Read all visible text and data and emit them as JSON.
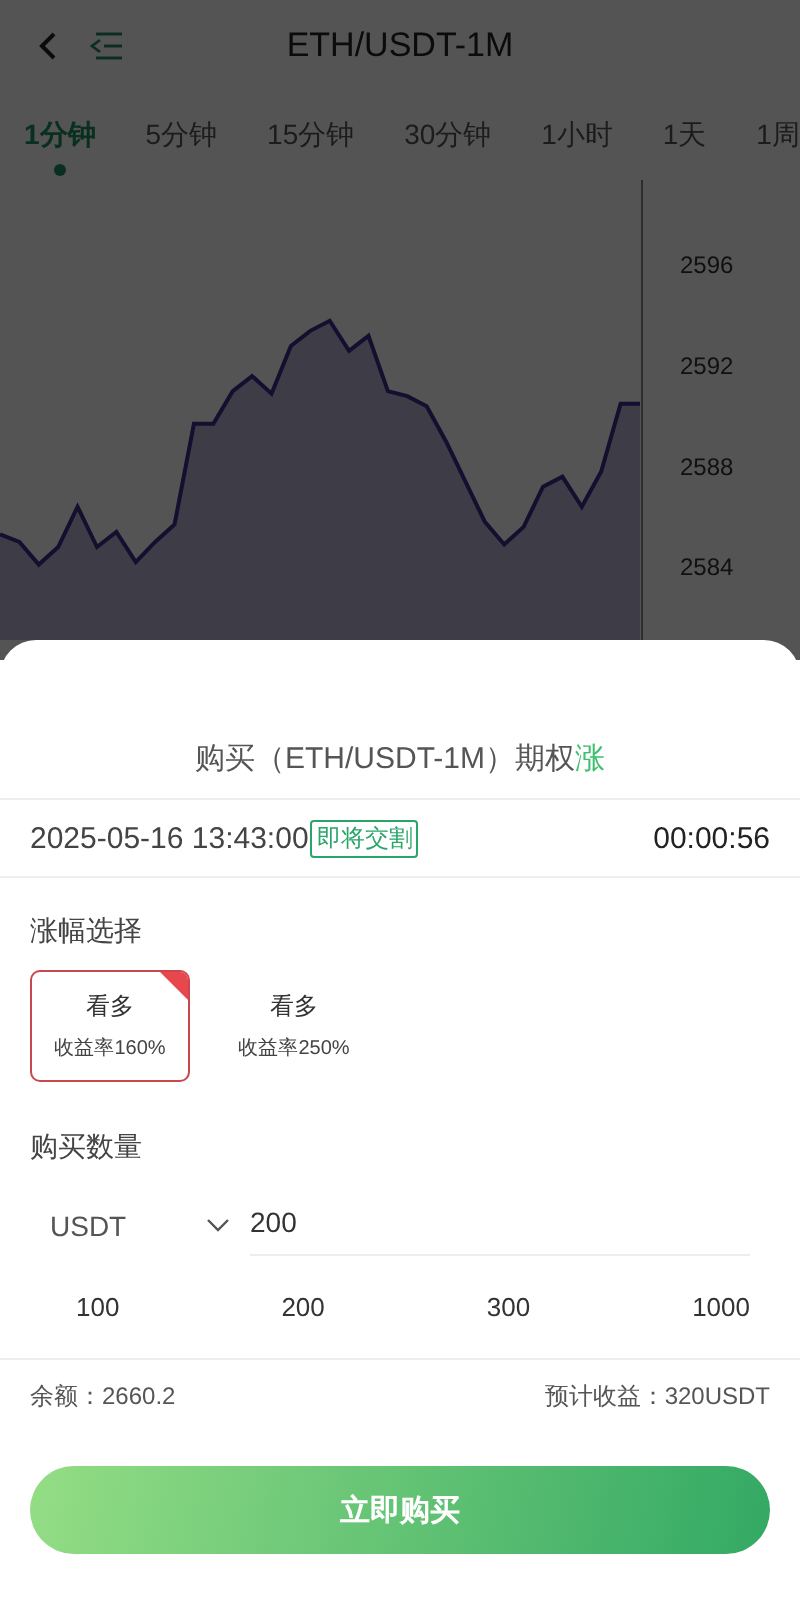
{
  "header": {
    "title": "ETH/USDT-1M"
  },
  "tabs": [
    {
      "label": "1分钟",
      "selected": true
    },
    {
      "label": "5分钟",
      "selected": false
    },
    {
      "label": "15分钟",
      "selected": false
    },
    {
      "label": "30分钟",
      "selected": false
    },
    {
      "label": "1小时",
      "selected": false
    },
    {
      "label": "1天",
      "selected": false
    },
    {
      "label": "1周",
      "selected": false
    }
  ],
  "chart": {
    "chart_data": {
      "type": "area",
      "ylim": [
        2581.1,
        2599.4
      ],
      "yticks": [
        2584,
        2588,
        2592,
        2596
      ],
      "series": [
        {
          "color": "#3b2f8f",
          "values": [
            2585.3,
            2585.0,
            2584.1,
            2584.8,
            2586.4,
            2584.8,
            2585.4,
            2584.2,
            2585.0,
            2585.7,
            2589.7,
            2589.7,
            2591.0,
            2591.6,
            2590.9,
            2592.8,
            2593.4,
            2593.8,
            2592.6,
            2593.2,
            2591.0,
            2590.8,
            2590.4,
            2589.0,
            2587.4,
            2585.8,
            2584.9,
            2585.6,
            2587.2,
            2587.6,
            2586.4,
            2587.8,
            2590.5,
            2590.5
          ]
        }
      ]
    }
  },
  "sheet": {
    "title": "购买（ETH/USDT-1M）期权",
    "direction": "涨",
    "time": "2025-05-16 13:43:00",
    "badge": "即将交割",
    "countdown": "00:00:56",
    "range_label": "涨幅选择",
    "options": [
      {
        "label": "看多",
        "rate": "收益率160%",
        "selected": true
      },
      {
        "label": "看多",
        "rate": "收益率250%",
        "selected": false
      }
    ],
    "amount_label": "购买数量",
    "currency": "USDT",
    "amount": "200",
    "presets": [
      "100",
      "200",
      "300",
      "1000"
    ],
    "balance": "余额：2660.2",
    "expected": "预计收益：320USDT",
    "buy_button": "立即购买"
  }
}
